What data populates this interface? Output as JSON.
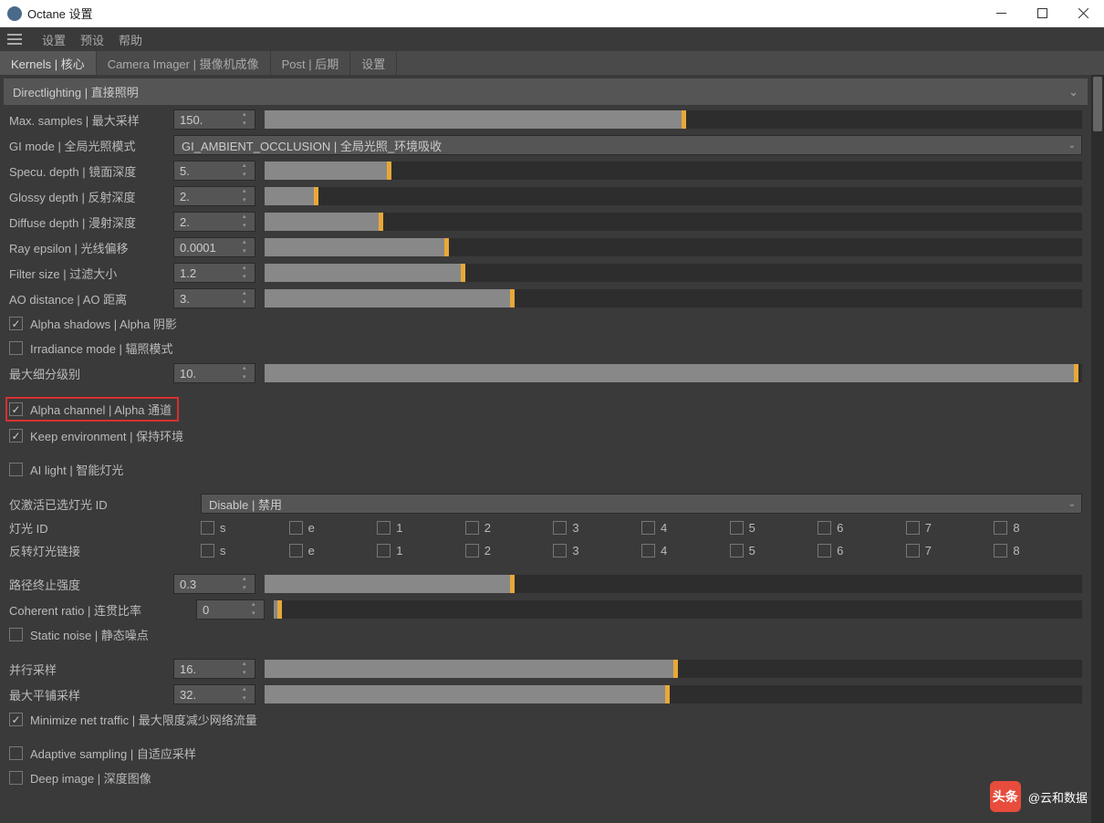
{
  "window": {
    "title": "Octane 设置"
  },
  "menu": {
    "settings": "设置",
    "presets": "预设",
    "help": "帮助"
  },
  "tabs": {
    "kernels": "Kernels | 核心",
    "camera": "Camera Imager | 摄像机成像",
    "post": "Post | 后期",
    "more": "设置"
  },
  "section": {
    "directlighting": "Directlighting | 直接照明"
  },
  "params": {
    "max_samples": {
      "label": "Max. samples | 最大采样",
      "value": "150.",
      "fill": 51
    },
    "gi_mode": {
      "label": "GI mode | 全局光照模式",
      "value": "GI_AMBIENT_OCCLUSION | 全局光照_环境吸收"
    },
    "specu_depth": {
      "label": "Specu. depth | 镜面深度",
      "value": "5.",
      "fill": 15
    },
    "glossy_depth": {
      "label": "Glossy depth | 反射深度",
      "value": "2.",
      "fill": 6
    },
    "diffuse_depth": {
      "label": "Diffuse depth | 漫射深度",
      "value": "2.",
      "fill": 14
    },
    "ray_epsilon": {
      "label": "Ray epsilon | 光线偏移",
      "value": "0.0001",
      "fill": 22
    },
    "filter_size": {
      "label": "Filter size | 过滤大小",
      "value": "1.2",
      "fill": 24
    },
    "ao_distance": {
      "label": "AO distance | AO 距离",
      "value": "3.",
      "fill": 30
    },
    "max_subdiv": {
      "label": "最大细分级别",
      "value": "10.",
      "fill": 99
    },
    "light_id_mode": {
      "label": "仅激活已选灯光 ID",
      "value": "Disable | 禁用"
    },
    "path_term": {
      "label": "路径终止强度",
      "value": "0.3",
      "fill": 30
    },
    "coherent": {
      "label": "Coherent ratio | 连贯比率",
      "value": "0",
      "fill": 0.5
    },
    "parallel": {
      "label": "并行采样",
      "value": "16.",
      "fill": 50
    },
    "max_tile": {
      "label": "最大平铺采样",
      "value": "32.",
      "fill": 49
    }
  },
  "checks": {
    "alpha_shadows": {
      "label": "Alpha shadows | Alpha 阴影",
      "checked": true
    },
    "irradiance": {
      "label": "Irradiance mode | 辐照模式",
      "checked": false
    },
    "alpha_channel": {
      "label": "Alpha channel | Alpha 通道",
      "checked": true
    },
    "keep_env": {
      "label": "Keep environment | 保持环境",
      "checked": true
    },
    "ai_light": {
      "label": "AI light | 智能灯光",
      "checked": false
    },
    "static_noise": {
      "label": "Static noise | 静态噪点",
      "checked": false
    },
    "min_net": {
      "label": "Minimize net traffic | 最大限度减少网络流量",
      "checked": true
    },
    "adaptive": {
      "label": "Adaptive sampling | 自适应采样",
      "checked": false
    },
    "deep_image": {
      "label": "Deep image | 深度图像",
      "checked": false
    }
  },
  "light_grid": {
    "row1_label": "灯光 ID",
    "row2_label": "反转灯光链接",
    "cols": [
      "s",
      "e",
      "1",
      "2",
      "3",
      "4",
      "5",
      "6",
      "7",
      "8"
    ]
  },
  "watermark": {
    "badge": "头条",
    "text": "@云和数据"
  }
}
